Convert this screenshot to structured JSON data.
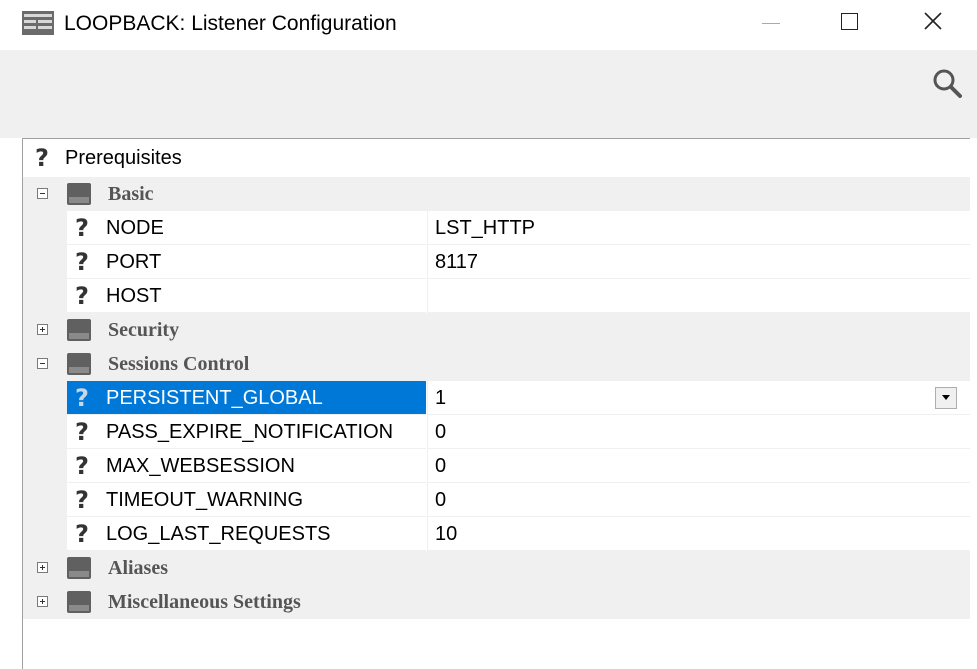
{
  "window": {
    "title": "LOOPBACK: Listener Configuration",
    "icons": {
      "app": "form-icon",
      "minimize": "minimize-icon",
      "maximize": "maximize-icon",
      "close": "close-icon"
    }
  },
  "toolbar": {
    "search_icon": "search-icon"
  },
  "grid": {
    "prerequisites_label": "Prerequisites",
    "sections": {
      "basic": {
        "label": "Basic",
        "expanded": true,
        "props": {
          "node": {
            "name": "NODE",
            "value": "LST_HTTP"
          },
          "port": {
            "name": "PORT",
            "value": "8117"
          },
          "host": {
            "name": "HOST",
            "value": ""
          }
        }
      },
      "security": {
        "label": "Security",
        "expanded": false
      },
      "sessions": {
        "label": "Sessions Control",
        "expanded": true,
        "props": {
          "persistent_global": {
            "name": "PERSISTENT_GLOBAL",
            "value": "1",
            "selected": true
          },
          "pass_expire_notification": {
            "name": "PASS_EXPIRE_NOTIFICATION",
            "value": "0"
          },
          "max_websession": {
            "name": "MAX_WEBSESSION",
            "value": "0"
          },
          "timeout_warning": {
            "name": "TIMEOUT_WARNING",
            "value": "0"
          },
          "log_last_requests": {
            "name": "LOG_LAST_REQUESTS",
            "value": "10"
          }
        }
      },
      "aliases": {
        "label": "Aliases",
        "expanded": false
      },
      "misc": {
        "label": "Miscellaneous Settings",
        "expanded": false
      }
    }
  },
  "colors": {
    "selection": "#0078d7",
    "category_bg": "#f0f0f0",
    "category_text": "#555555"
  }
}
